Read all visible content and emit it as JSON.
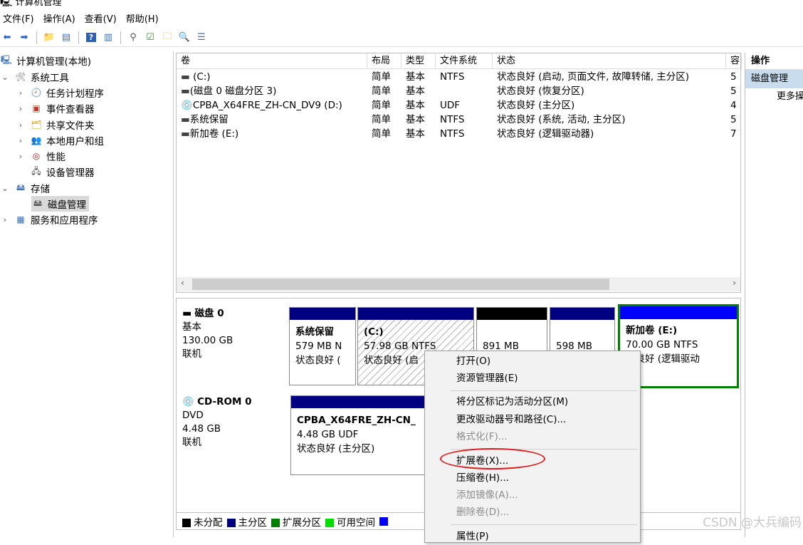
{
  "window": {
    "title": "计算机管理"
  },
  "menu": [
    "文件(F)",
    "操作(A)",
    "查看(V)",
    "帮助(H)"
  ],
  "tree": {
    "root": "计算机管理(本地)",
    "system_tools": "系统工具",
    "task_scheduler": "任务计划程序",
    "event_viewer": "事件查看器",
    "shared_folders": "共享文件夹",
    "local_users": "本地用户和组",
    "performance": "性能",
    "device_manager": "设备管理器",
    "storage": "存储",
    "disk_management": "磁盘管理",
    "services": "服务和应用程序"
  },
  "volumes": {
    "headers": [
      "卷",
      "布局",
      "类型",
      "文件系统",
      "状态",
      "容"
    ],
    "rows": [
      {
        "name": "(C:)",
        "layout": "简单",
        "type": "基本",
        "fs": "NTFS",
        "status": "状态良好 (启动, 页面文件, 故障转储, 主分区)",
        "cap": "5"
      },
      {
        "name": "(磁盘 0 磁盘分区 3)",
        "layout": "简单",
        "type": "基本",
        "fs": "",
        "status": "状态良好 (恢复分区)",
        "cap": "5"
      },
      {
        "name": "CPBA_X64FRE_ZH-CN_DV9 (D:)",
        "layout": "简单",
        "type": "基本",
        "fs": "UDF",
        "status": "状态良好 (主分区)",
        "cap": "4"
      },
      {
        "name": "系统保留",
        "layout": "简单",
        "type": "基本",
        "fs": "NTFS",
        "status": "状态良好 (系统, 活动, 主分区)",
        "cap": "5"
      },
      {
        "name": "新加卷 (E:)",
        "layout": "简单",
        "type": "基本",
        "fs": "NTFS",
        "status": "状态良好 (逻辑驱动器)",
        "cap": "7"
      }
    ]
  },
  "disk0": {
    "name": "磁盘 0",
    "kind": "基本",
    "size": "130.00 GB",
    "state": "联机",
    "partitions": [
      {
        "title": "系统保留",
        "line2": "579 MB N",
        "line3": "状态良好 ("
      },
      {
        "title": "(C:)",
        "line2": "57.98 GB NTFS",
        "line3": "状态良好 (启"
      },
      {
        "title": "",
        "line2": "891 MB",
        "line3": ""
      },
      {
        "title": "",
        "line2": "598 MB",
        "line3": ""
      },
      {
        "title": "新加卷 (E:)",
        "line2": "70.00 GB NTFS",
        "line3": "态良好 (逻辑驱动"
      }
    ]
  },
  "cdrom0": {
    "name": "CD-ROM 0",
    "kind": "DVD",
    "size": "4.48 GB",
    "state": "联机",
    "partition": {
      "title": "CPBA_X64FRE_ZH-CN_",
      "line2": "4.48 GB UDF",
      "line3": "状态良好 (主分区)"
    }
  },
  "legend": [
    "未分配",
    "主分区",
    "扩展分区",
    "可用空间",
    ""
  ],
  "colors": {
    "unallocated": "#000000",
    "primary": "#000080",
    "extended": "#008000",
    "free": "#00e000",
    "logical": "#0000ff",
    "selection_border": "#008000"
  },
  "actions": {
    "header": "操作",
    "section": "磁盘管理",
    "more": "更多操"
  },
  "context_menu": {
    "items": [
      {
        "label": "打开(O)",
        "enabled": true
      },
      {
        "label": "资源管理器(E)",
        "enabled": true
      },
      {
        "label": "将分区标记为活动分区(M)",
        "enabled": true
      },
      {
        "label": "更改驱动器号和路径(C)...",
        "enabled": true
      },
      {
        "label": "格式化(F)...",
        "enabled": false
      },
      {
        "label": "扩展卷(X)...",
        "enabled": true
      },
      {
        "label": "压缩卷(H)...",
        "enabled": true
      },
      {
        "label": "添加镜像(A)...",
        "enabled": false
      },
      {
        "label": "删除卷(D)...",
        "enabled": false
      },
      {
        "label": "属性(P)",
        "enabled": true
      }
    ]
  },
  "watermark": "CSDN @大兵编码"
}
